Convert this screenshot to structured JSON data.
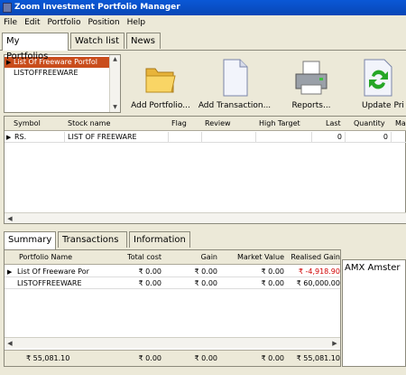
{
  "window": {
    "title": "Zoom Investment Portfolio Manager"
  },
  "menu": [
    "File",
    "Edit",
    "Portfolio",
    "Position",
    "Help"
  ],
  "main_tabs": [
    "My Portfolios",
    "Watch list",
    "News"
  ],
  "portfolio_list": [
    "List Of Freeware Portfol",
    "LISTOFFREEWARE"
  ],
  "toolbar": {
    "add_portfolio": "Add Portfolio...",
    "add_transaction": "Add Transaction...",
    "reports": "Reports...",
    "update_prices": "Update Pri"
  },
  "positions_table": {
    "headers": [
      "Symbol",
      "Stock name",
      "Flag",
      "Review",
      "High Target",
      "Last",
      "Quantity",
      "Ma"
    ],
    "rows": [
      {
        "symbol": "RS.",
        "stock_name": "LIST OF FREEWARE",
        "flag": "",
        "review": "",
        "high_target": "",
        "last": "0",
        "quantity": "0"
      }
    ]
  },
  "lower_tabs": [
    "Summary",
    "Transactions",
    "Information"
  ],
  "summary_table": {
    "headers": [
      "Portfolio Name",
      "Total cost",
      "Gain",
      "Market Value",
      "Realised Gain"
    ],
    "rows": [
      {
        "name": "List Of Freeware Por",
        "total_cost": "₹ 0.00",
        "gain": "₹ 0.00",
        "market_value": "₹ 0.00",
        "realised_gain": "₹ -4,918.90"
      },
      {
        "name": "LISTOFFREEWARE",
        "total_cost": "₹ 0.00",
        "gain": "₹ 0.00",
        "market_value": "₹ 0.00",
        "realised_gain": "₹ 60,000.00"
      }
    ],
    "totals": {
      "name": "₹ 55,081.10",
      "total_cost": "₹ 0.00",
      "gain": "₹ 0.00",
      "market_value": "₹ 0.00",
      "realised_gain": "₹ 55,081.10"
    }
  },
  "ticker": {
    "text": "AMX  Amster"
  },
  "colors": {
    "titlebar": "#0a58d6",
    "selection": "#c94d1c",
    "negative": "#d00000"
  }
}
